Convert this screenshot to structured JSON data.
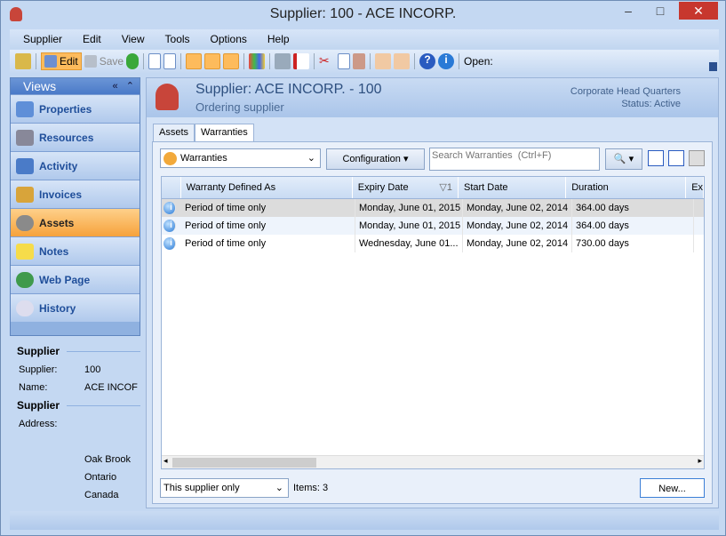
{
  "window": {
    "title": "Supplier: 100 - ACE INCORP.",
    "minimize": "–",
    "maximize": "□",
    "close": "✕"
  },
  "menu": [
    "Supplier",
    "Edit",
    "View",
    "Tools",
    "Options",
    "Help"
  ],
  "toolbar": {
    "edit": "Edit",
    "save": "Save",
    "open": "Open:"
  },
  "views": {
    "title": "Views",
    "collapse": "«",
    "up": "⌃",
    "items": [
      "Properties",
      "Resources",
      "Activity",
      "Invoices",
      "Assets",
      "Notes",
      "Web Page",
      "History"
    ],
    "active": 4
  },
  "info": {
    "section1": "Supplier",
    "supplier_label": "Supplier:",
    "supplier_value": "100",
    "name_label": "Name:",
    "name_value": "ACE INCOF",
    "section2": "Supplier",
    "address_label": "Address:",
    "address_lines": [
      "Oak Brook",
      "Ontario",
      "Canada"
    ]
  },
  "header": {
    "title": "Supplier: ACE INCORP. - 100",
    "subtitle": "Ordering supplier",
    "location": "Corporate Head Quarters",
    "status": "Status: Active"
  },
  "tabs": [
    "Assets",
    "Warranties"
  ],
  "filter": {
    "view": "Warranties",
    "configuration": "Configuration",
    "search_placeholder": "Search Warranties  (Ctrl+F)",
    "scope": "This supplier only",
    "items": "Items: 3",
    "new": "New..."
  },
  "grid": {
    "columns": [
      "Warranty Defined As",
      "Expiry Date",
      "Start Date",
      "Duration",
      "Ex"
    ],
    "sort_indicator": "▽1",
    "rows": [
      [
        "Period of time only",
        "Monday, June 01, 2015",
        "Monday, June 02, 2014",
        "364.00 days"
      ],
      [
        "Period of time only",
        "Monday, June 01, 2015",
        "Monday, June 02, 2014",
        "364.00 days"
      ],
      [
        "Period of time only",
        "Wednesday, June 01...",
        "Monday, June 02, 2014",
        "730.00 days"
      ]
    ]
  }
}
